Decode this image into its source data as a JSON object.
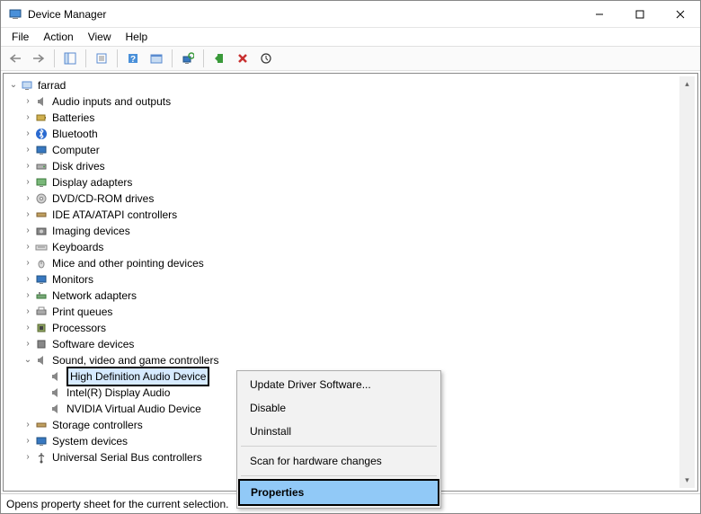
{
  "window": {
    "title": "Device Manager"
  },
  "menu": {
    "file": "File",
    "action": "Action",
    "view": "View",
    "help": "Help"
  },
  "tree": {
    "root": "farrad",
    "items": [
      "Audio inputs and outputs",
      "Batteries",
      "Bluetooth",
      "Computer",
      "Disk drives",
      "Display adapters",
      "DVD/CD-ROM drives",
      "IDE ATA/ATAPI controllers",
      "Imaging devices",
      "Keyboards",
      "Mice and other pointing devices",
      "Monitors",
      "Network adapters",
      "Print queues",
      "Processors",
      "Software devices",
      "Sound, video and game controllers",
      "Storage controllers",
      "System devices",
      "Universal Serial Bus controllers"
    ],
    "sound_children": [
      "High Definition Audio Device",
      "Intel(R) Display Audio",
      "NVIDIA Virtual Audio Device"
    ]
  },
  "context_menu": {
    "update": "Update Driver Software...",
    "disable": "Disable",
    "uninstall": "Uninstall",
    "scan": "Scan for hardware changes",
    "properties": "Properties"
  },
  "status": {
    "text": "Opens property sheet for the current selection."
  }
}
